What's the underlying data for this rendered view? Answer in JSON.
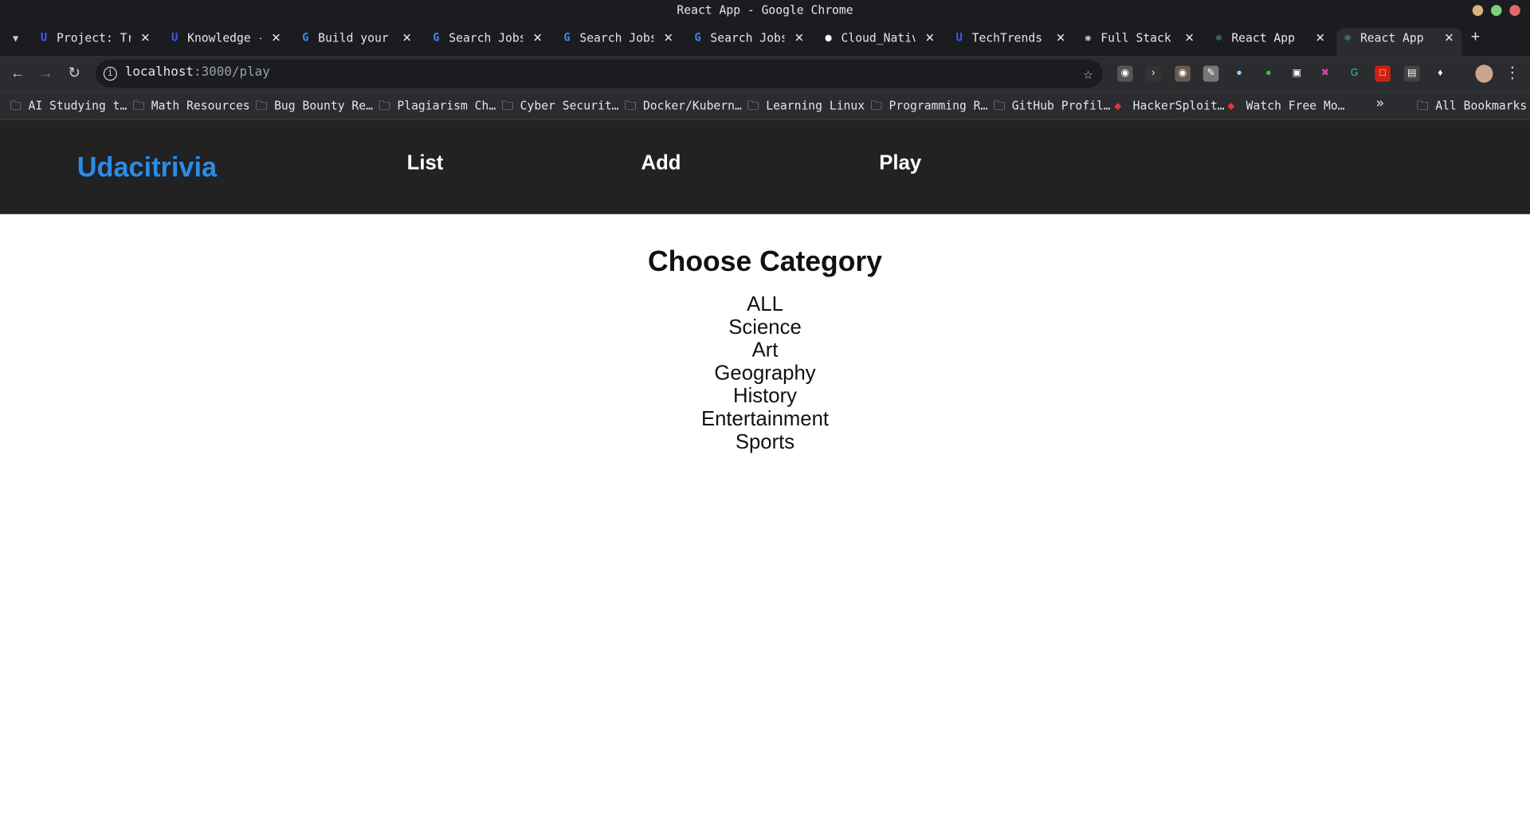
{
  "window": {
    "title": "React App - Google Chrome",
    "controls": [
      {
        "name": "minimize",
        "color": "#d5b57a"
      },
      {
        "name": "maximize",
        "color": "#7bd17b"
      },
      {
        "name": "close",
        "color": "#e06a6a"
      }
    ]
  },
  "tabs": [
    {
      "title": "Project: Tr",
      "favicon": "udacity-icon",
      "color": "#3d5afe"
    },
    {
      "title": "Knowledge -",
      "favicon": "udacity-icon",
      "color": "#3d5afe"
    },
    {
      "title": "Build your",
      "favicon": "google-icon",
      "color": "#ffffff"
    },
    {
      "title": "Search Jobs",
      "favicon": "google-icon",
      "color": "#ffffff"
    },
    {
      "title": "Search Jobs",
      "favicon": "google-icon",
      "color": "#ffffff"
    },
    {
      "title": "Search Jobs",
      "favicon": "google-icon",
      "color": "#ffffff"
    },
    {
      "title": "Cloud_Nativ",
      "favicon": "github-icon",
      "color": "#ffffff"
    },
    {
      "title": "TechTrends -",
      "favicon": "udacity-icon",
      "color": "#3d5afe"
    },
    {
      "title": "Full Stack",
      "favicon": "openai-icon",
      "color": "#ffffff"
    },
    {
      "title": "React App",
      "favicon": "react-icon",
      "color": "#61dafb"
    },
    {
      "title": "React App",
      "favicon": "react-icon",
      "color": "#61dafb"
    }
  ],
  "omnibox": {
    "host": "localhost",
    "path": ":3000/play"
  },
  "bookmarks": [
    "AI Studying t…",
    "Math Resources",
    "Bug Bounty Re…",
    "Plagiarism Ch…",
    "Cyber Securit…",
    "Docker/Kubern…",
    "Learning Linux",
    "Programming R…",
    "GitHub Profil…",
    "HackerSploit…",
    "Watch Free Mo…"
  ],
  "all_bookmarks": "All Bookmarks",
  "app": {
    "brand": "Udacitrivia",
    "nav": {
      "list": "List",
      "add": "Add",
      "play": "Play"
    },
    "title": "Choose Category",
    "categories": [
      "ALL",
      "Science",
      "Art",
      "Geography",
      "History",
      "Entertainment",
      "Sports"
    ]
  },
  "colors": {
    "brand": "#2a8be8",
    "header_bg": "#222222"
  }
}
